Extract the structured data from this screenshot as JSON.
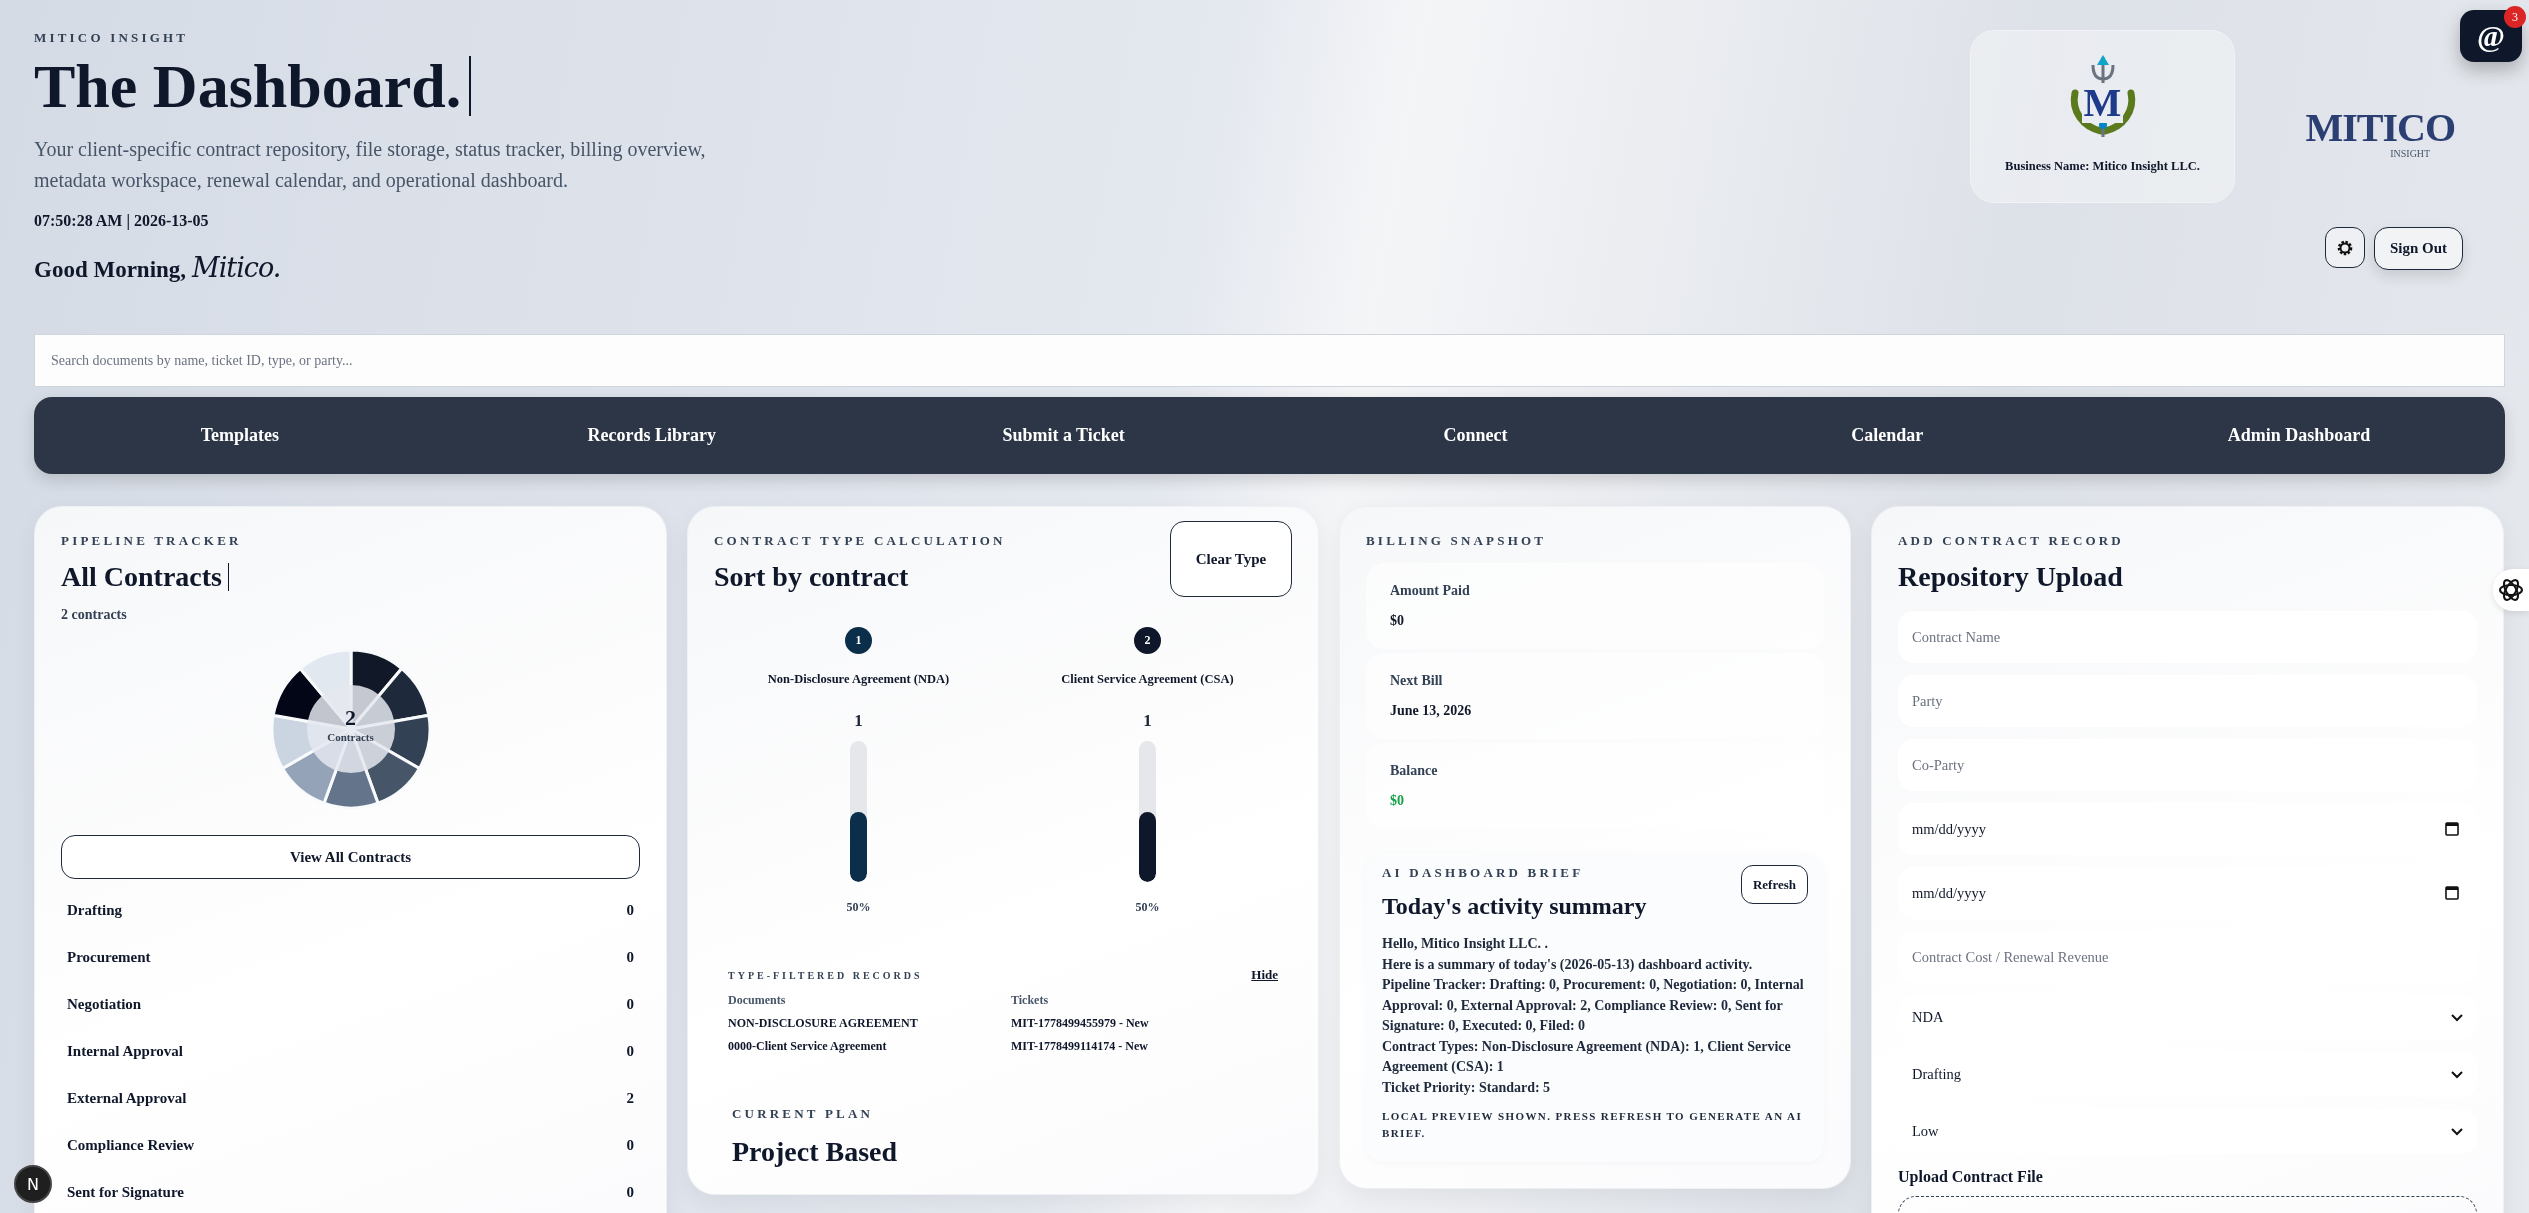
{
  "header": {
    "eyebrow": "MITICO INSIGHT",
    "title": "The Dashboard.",
    "description": "Your client-specific contract repository, file storage, status tracker, billing overview, metadata workspace, renewal calendar, and operational dashboard.",
    "timestamp": "07:50:28 AM | 2026-13-05",
    "greeting": "Good Morning,",
    "greeting_name": "Mitico."
  },
  "business_card": {
    "emblem_letter": "M",
    "label": "Business Name: Mitico Insight LLC."
  },
  "wordmark": {
    "name": "MITICO",
    "tagline": "INSIGHT"
  },
  "sign_out": "Sign Out",
  "notifications": {
    "glyph": "@",
    "count": "3"
  },
  "search": {
    "placeholder": "Search documents by name, ticket ID, type, or party..."
  },
  "nav": [
    {
      "label": "Templates"
    },
    {
      "label": "Records Library"
    },
    {
      "label": "Submit a Ticket"
    },
    {
      "label": "Connect"
    },
    {
      "label": "Calendar"
    },
    {
      "label": "Admin Dashboard"
    }
  ],
  "pipeline": {
    "eyebrow": "PIPELINE TRACKER",
    "title": "All Contracts",
    "count": "2 contracts",
    "ring_total": "2",
    "ring_label": "Contracts",
    "button": "View All Contracts",
    "stages": [
      {
        "label": "Drafting",
        "value": "0"
      },
      {
        "label": "Procurement",
        "value": "0"
      },
      {
        "label": "Negotiation",
        "value": "0"
      },
      {
        "label": "Internal Approval",
        "value": "0"
      },
      {
        "label": "External Approval",
        "value": "2"
      },
      {
        "label": "Compliance Review",
        "value": "0"
      },
      {
        "label": "Sent for Signature",
        "value": "0"
      }
    ]
  },
  "contract_types": {
    "eyebrow": "CONTRACT TYPE CALCULATION",
    "title": "Sort by contract",
    "clear_button": "Clear Type",
    "types": [
      {
        "rank": "1",
        "label": "Non-Disclosure Agreement (NDA)",
        "count": "1",
        "level": 0.5,
        "percent": "50%",
        "color": "#0b2e4a"
      },
      {
        "rank": "2",
        "label": "Client Service Agreement (CSA)",
        "count": "1",
        "level": 0.5,
        "percent": "50%",
        "color": "#0f172a"
      }
    ],
    "records": {
      "eyebrow": "TYPE-FILTERED RECORDS",
      "hide": "Hide",
      "columns": [
        "Documents",
        "Tickets"
      ],
      "rows": [
        [
          "NON-DISCLOSURE AGREEMENT",
          "MIT-1778499455979 - New"
        ],
        [
          "0000-Client Service Agreement",
          "MIT-1778499114174 - New"
        ]
      ]
    },
    "plan": {
      "eyebrow": "CURRENT PLAN",
      "title": "Project Based"
    }
  },
  "billing": {
    "eyebrow": "BILLING SNAPSHOT",
    "items": [
      {
        "label": "Amount Paid",
        "value": "$0",
        "color": "#111827"
      },
      {
        "label": "Next Bill",
        "value": "June 13, 2026",
        "color": "#111827"
      },
      {
        "label": "Balance",
        "value": "$0",
        "color": "#16a34a"
      }
    ]
  },
  "brief": {
    "eyebrow": "AI DASHBOARD BRIEF",
    "title": "Today's activity summary",
    "refresh": "Refresh",
    "lines": [
      "Hello, Mitico Insight LLC. .",
      "Here is a summary of today's (2026-05-13) dashboard activity.",
      "Pipeline Tracker: Drafting: 0, Procurement: 0, Negotiation: 0, Internal Approval: 0, External Approval: 2, Compliance Review: 0, Sent for Signature: 0, Executed: 0, Filed: 0",
      "Contract Types: Non-Disclosure Agreement (NDA): 1, Client Service Agreement (CSA): 1",
      "Ticket Priority: Standard: 5"
    ],
    "note": "LOCAL PREVIEW SHOWN. PRESS REFRESH TO GENERATE AN AI BRIEF."
  },
  "upload": {
    "eyebrow": "ADD CONTRACT RECORD",
    "title": "Repository Upload",
    "fields": [
      {
        "kind": "text",
        "placeholder": "Contract Name"
      },
      {
        "kind": "text",
        "placeholder": "Party"
      },
      {
        "kind": "text",
        "placeholder": "Co-Party"
      },
      {
        "kind": "date",
        "placeholder": "mm/dd/yyyy"
      },
      {
        "kind": "date",
        "placeholder": "mm/dd/yyyy"
      },
      {
        "kind": "text",
        "placeholder": "Contract Cost / Renewal Revenue"
      },
      {
        "kind": "select",
        "value": "NDA"
      },
      {
        "kind": "select",
        "value": "Drafting"
      },
      {
        "kind": "select",
        "value": "Low"
      }
    ],
    "file_label": "Upload Contract File"
  },
  "dev_badge": "N"
}
